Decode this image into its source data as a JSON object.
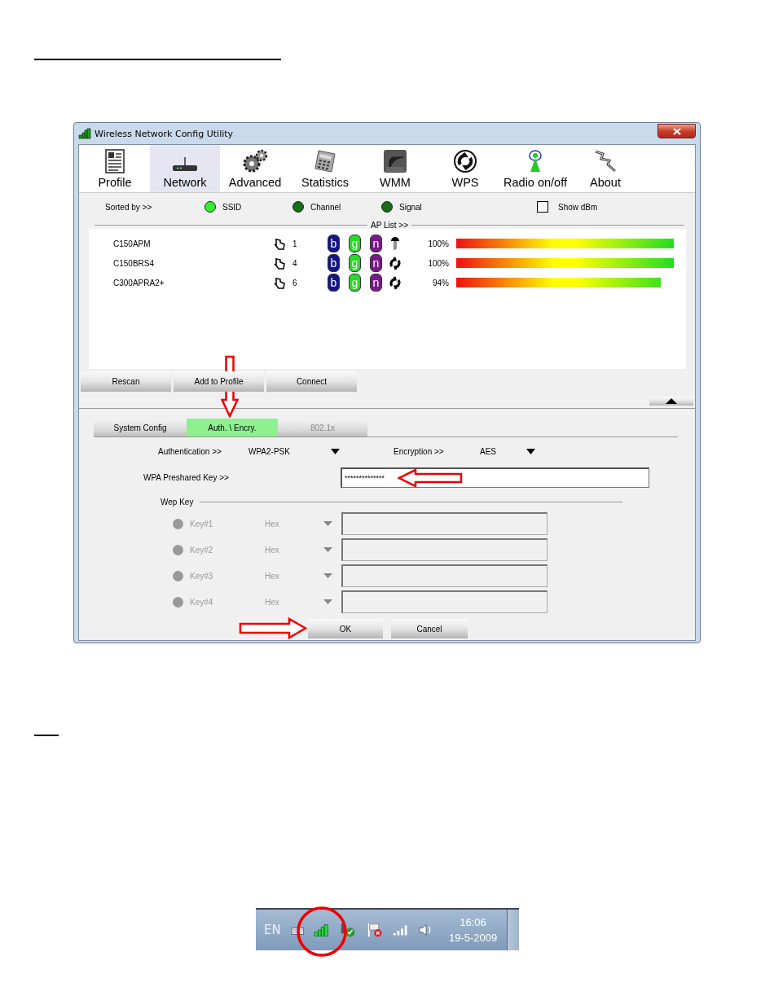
{
  "window": {
    "title": "Wireless Network Config Utility"
  },
  "toolbar": [
    {
      "label": "Profile",
      "kind": "profile",
      "selected": false
    },
    {
      "label": "Network",
      "kind": "network",
      "selected": true
    },
    {
      "label": "Advanced",
      "kind": "advanced",
      "selected": false
    },
    {
      "label": "Statistics",
      "kind": "statistics",
      "selected": false
    },
    {
      "label": "WMM",
      "kind": "wmm",
      "selected": false
    },
    {
      "label": "WPS",
      "kind": "wps",
      "selected": false
    },
    {
      "label": "Radio on/off",
      "kind": "radio",
      "selected": false
    },
    {
      "label": "About",
      "kind": "about",
      "selected": false
    }
  ],
  "sort": {
    "label": "Sorted by >>",
    "options": [
      {
        "label": "SSID",
        "selected": true
      },
      {
        "label": "Channel",
        "selected": false
      },
      {
        "label": "Signal",
        "selected": false
      }
    ]
  },
  "show_dbm": {
    "label": "Show dBm",
    "checked": false
  },
  "ap_list": {
    "title": "AP List >>",
    "rows": [
      {
        "ssid": "C150APM",
        "channel": "1",
        "modes": [
          {
            "label": "b",
            "color": "#15158a"
          },
          {
            "label": "g",
            "color": "#22dd22"
          },
          {
            "label": "n",
            "color": "#7a1a8a"
          }
        ],
        "kind": "key",
        "signal": "100%",
        "level": 1
      },
      {
        "ssid": "C150BRS4",
        "channel": "4",
        "modes": [
          {
            "label": "b",
            "color": "#15158a"
          },
          {
            "label": "g",
            "color": "#22dd22"
          },
          {
            "label": "n",
            "color": "#7a1a8a"
          }
        ],
        "kind": "wps",
        "signal": "100%",
        "level": 1
      },
      {
        "ssid": "C300APRA2+",
        "channel": "6",
        "modes": [
          {
            "label": "b",
            "color": "#15158a"
          },
          {
            "label": "g",
            "color": "#22dd22"
          },
          {
            "label": "n",
            "color": "#7a1a8a"
          }
        ],
        "kind": "wps",
        "signal": "94%",
        "level": 0.94
      }
    ]
  },
  "list_buttons": [
    "Rescan",
    "Add to Profile",
    "Connect"
  ],
  "tabs": [
    {
      "label": "System Config",
      "selected": false,
      "disabled": false
    },
    {
      "label": "Auth. \\ Encry.",
      "selected": true,
      "disabled": false
    },
    {
      "label": "802.1x",
      "selected": false,
      "disabled": true
    }
  ],
  "authentication": {
    "label": "Authentication >>",
    "value": "WPA2-PSK"
  },
  "encryption": {
    "label": "Encryption >>",
    "value": "AES"
  },
  "wpa_key": {
    "label": "WPA Preshared Key >>",
    "value": "**************"
  },
  "wep": {
    "title": "Wep Key",
    "keys": [
      {
        "label": "Key#1",
        "format": "Hex",
        "disabled": true
      },
      {
        "label": "Key#2",
        "format": "Hex",
        "disabled": true
      },
      {
        "label": "Key#3",
        "format": "Hex",
        "disabled": true
      },
      {
        "label": "Key#4",
        "format": "Hex",
        "disabled": true
      }
    ]
  },
  "dialog_buttons": [
    "OK",
    "Cancel"
  ],
  "taskbar": {
    "language": "EN",
    "time": "16:06",
    "date": "19-5-2009"
  }
}
